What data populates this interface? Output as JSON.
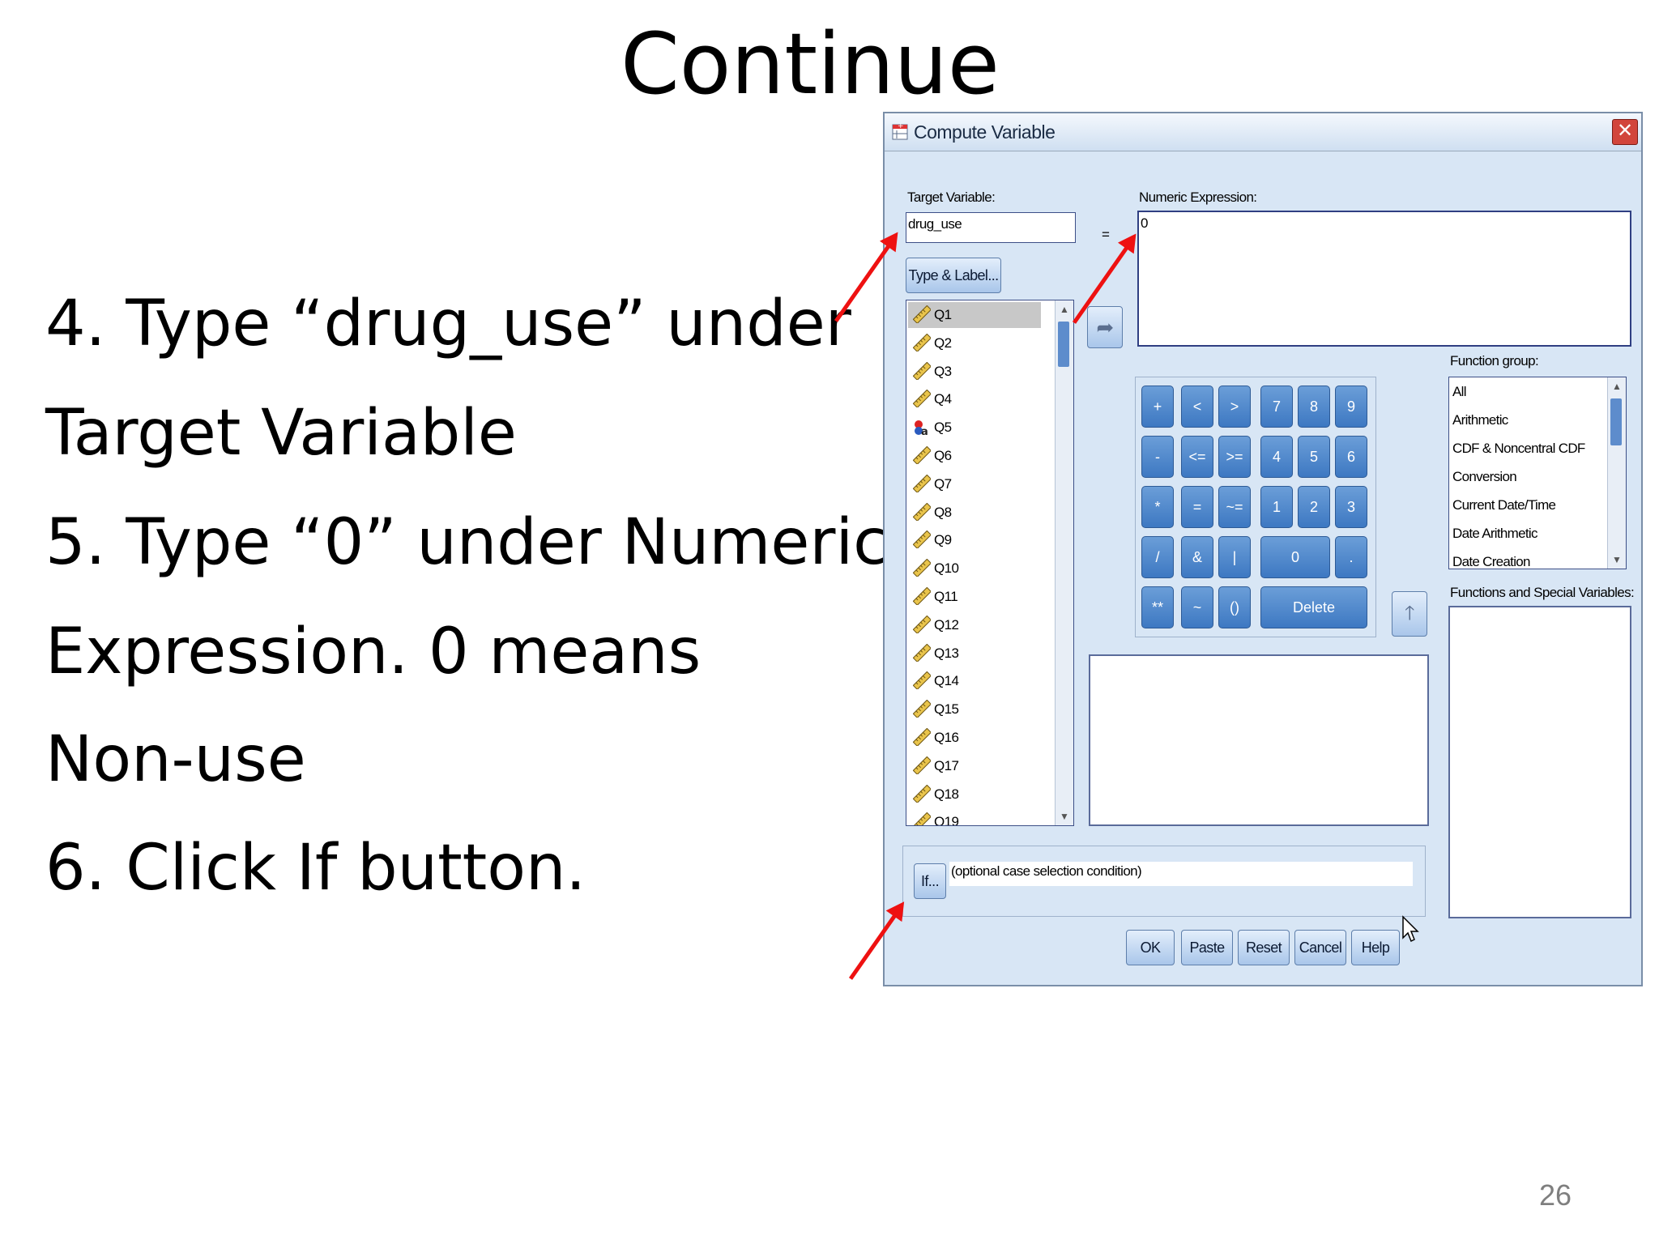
{
  "slide": {
    "title": "Continue",
    "instructions": [
      "4. Type “drug_use” under",
      "Target Variable",
      "5. Type “0” under Numeric",
      "Expression. 0 means",
      "Non-use",
      "6.  Click If button."
    ],
    "page_number": "26"
  },
  "dialog": {
    "title": "Compute Variable",
    "close_label": "✕",
    "target_variable_label": "Target Variable:",
    "target_variable_value": "drug_use",
    "equals_sign": "=",
    "numeric_expression_label": "Numeric Expression:",
    "numeric_expression_value": "0",
    "type_label_button": "Type & Label...",
    "variables": [
      "Q1",
      "Q2",
      "Q3",
      "Q4",
      "Q5",
      "Q6",
      "Q7",
      "Q8",
      "Q9",
      "Q10",
      "Q11",
      "Q12",
      "Q13",
      "Q14",
      "Q15",
      "Q16",
      "Q17",
      "Q18",
      "Q19"
    ],
    "keypad": {
      "plus": "+",
      "lt": "<",
      "gt": ">",
      "k7": "7",
      "k8": "8",
      "k9": "9",
      "minus": "-",
      "le": "<=",
      "ge": ">=",
      "k4": "4",
      "k5": "5",
      "k6": "6",
      "times": "*",
      "eq": "=",
      "ne": "~=",
      "k1": "1",
      "k2": "2",
      "k3": "3",
      "divide": "/",
      "and": "&",
      "or": "|",
      "k0": "0",
      "dot": ".",
      "power": "**",
      "not": "~",
      "parens": "()",
      "delete": "Delete"
    },
    "function_group_label": "Function group:",
    "function_groups": [
      "All",
      "Arithmetic",
      "CDF & Noncentral CDF",
      "Conversion",
      "Current Date/Time",
      "Date Arithmetic",
      "Date Creation"
    ],
    "functions_label": "Functions and Special Variables:",
    "if_button": "If...",
    "if_condition_text": "(optional case selection condition)",
    "buttons": {
      "ok": "OK",
      "paste": "Paste",
      "reset": "Reset",
      "cancel": "Cancel",
      "help": "Help"
    }
  },
  "colors": {
    "annotation_arrow": "#ee1111",
    "dialog_background": "#d8e6f5",
    "keypad_key": "#3d78c2"
  },
  "icons": {
    "variable": "ruler-icon",
    "string_variable": "nominal-a-icon",
    "move_right": "arrow-left-icon",
    "move_up": "arrow-up-icon"
  }
}
